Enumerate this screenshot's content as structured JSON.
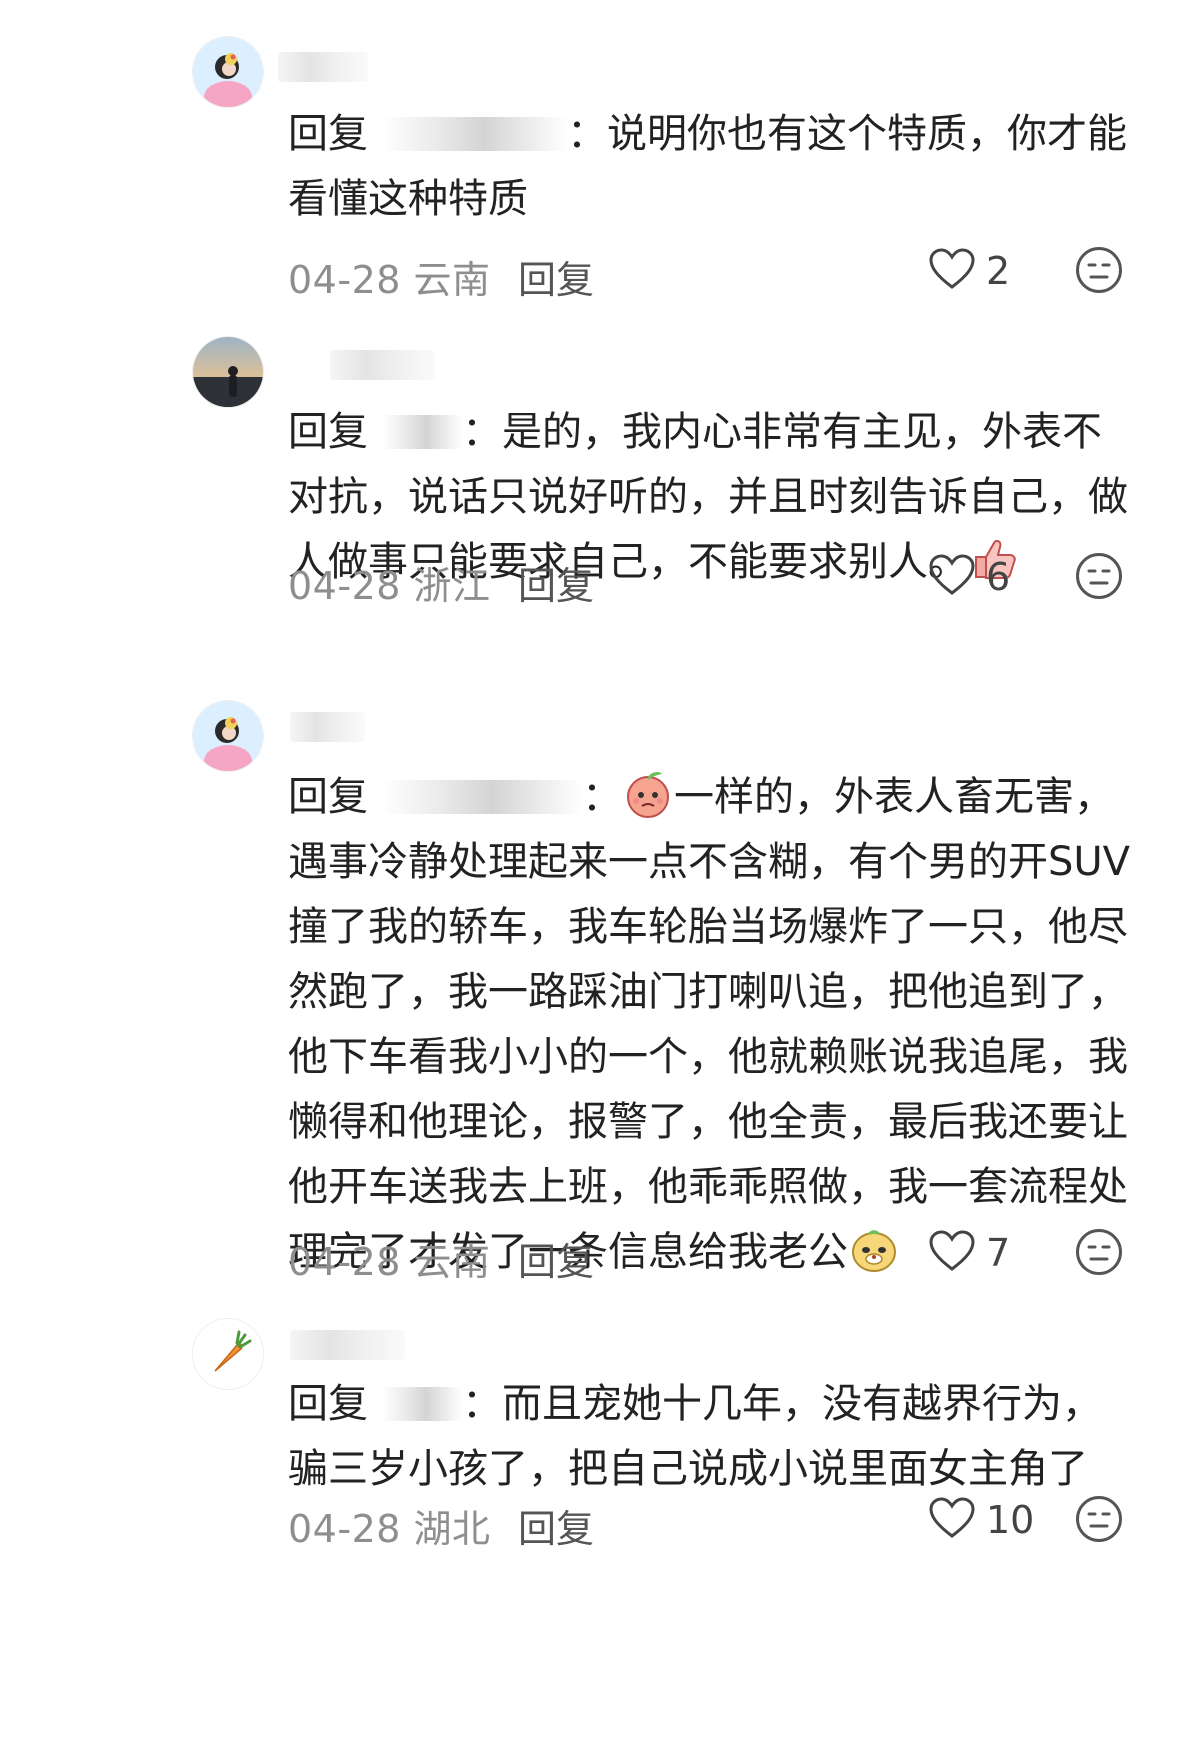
{
  "comments": [
    {
      "reply_prefix": "回复",
      "text": "：说明你也有这个特质，你才能看懂这种特质",
      "date": "04-28",
      "location": "云南",
      "reply_label": "回复",
      "likes": "2"
    },
    {
      "reply_prefix": "回复",
      "text": "：是的，我内心非常有主见，外表不对抗，说话只说好听的，并且时刻告诉自己，做人做事只能要求自己，不能要求别人。",
      "date": "04-28",
      "location": "浙江",
      "reply_label": "回复",
      "likes": "6"
    },
    {
      "reply_prefix": "回复",
      "text_part1": "：",
      "text_part2": "一样的，外表人畜无害，遇事冷静处理起来一点不含糊，有个男的开SUV撞了我的轿车，我车轮胎当场爆炸了一只，他尽然跑了，我一路踩油门打喇叭追，把他追到了，他下车看我小小的一个，他就赖账说我追尾，我懒得和他理论，报警了，他全责，最后我还要让他开车送我去上班，他乖乖照做，我一套流程处理完了才发了一条信息给我老公",
      "date": "04-28",
      "location": "云南",
      "reply_label": "回复",
      "likes": "7"
    },
    {
      "reply_prefix": "回复",
      "text": "：而且宠她十几年，没有越界行为，骗三岁小孩了，把自己说成小说里面女主角了",
      "date": "04-28",
      "location": "湖北",
      "reply_label": "回复",
      "likes": "10"
    }
  ],
  "icons": {
    "like": "heart-outline-icon",
    "react": "emoji-face-icon",
    "emoji_thumbs_up": "thumbs-up-emoji",
    "emoji_peach": "shy-peach-emoji",
    "emoji_smug": "smug-face-emoji",
    "avatar_carrot": "carrot-icon"
  },
  "colors": {
    "text": "#222222",
    "meta": "#8e8e8e",
    "background": "#ffffff"
  }
}
